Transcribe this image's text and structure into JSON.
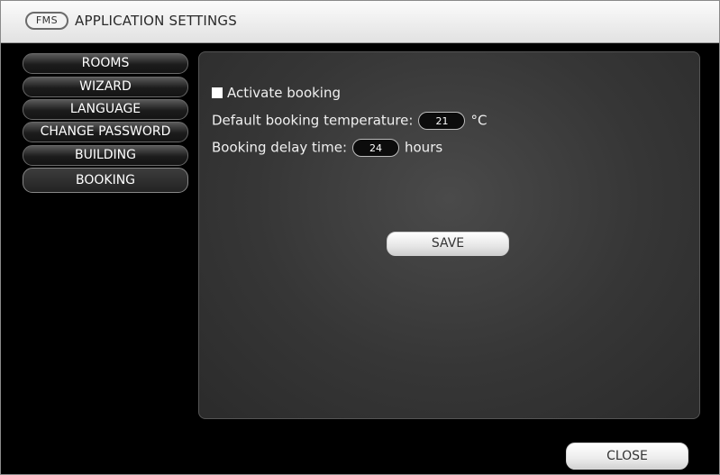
{
  "titlebar": {
    "logo_text": "FMS",
    "title": "APPLICATION SETTINGS"
  },
  "sidebar": {
    "items": [
      {
        "label": "ROOMS",
        "active": false
      },
      {
        "label": "WIZARD",
        "active": false
      },
      {
        "label": "LANGUAGE",
        "active": false
      },
      {
        "label": "CHANGE PASSWORD",
        "active": false
      },
      {
        "label": "BUILDING",
        "active": false
      },
      {
        "label": "BOOKING",
        "active": true
      }
    ]
  },
  "booking": {
    "activate_label": "Activate booking",
    "temperature_label": "Default booking temperature:",
    "temperature_value": "21",
    "temperature_unit": "°C",
    "delay_label": "Booking delay time:",
    "delay_value": "24",
    "delay_unit": "hours",
    "save_label": "SAVE"
  },
  "footer": {
    "close_label": "CLOSE"
  }
}
